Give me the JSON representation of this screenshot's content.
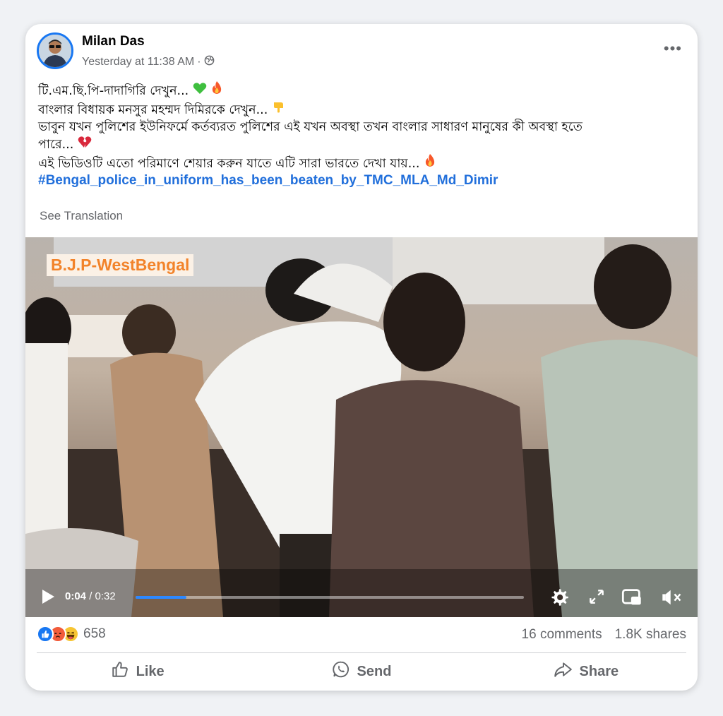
{
  "post": {
    "author": "Milan Das",
    "timestamp": "Yesterday at 11:38 AM",
    "separator": "·",
    "privacy_icon": "globe-icon",
    "more_label": "•••",
    "text_lines": [
      "টি.এম.ছি.পি-দাদাগিরি দেখুন...",
      "বাংলার বিধায়ক মনসুর মহম্মদ দিমিরকে দেখুন...",
      "ভাবুন যখন পুলিশের ইউনিফর্মে কর্তব্যরত পুলিশের এই যখন অবস্থা তখন বাংলার সাধারণ মানুষের কী অবস্থা হতে",
      "পারে...",
      "এই ভিডিওটি এতো পরিমাণে শেয়ার করুন যাতে এটি সারা ভারতে দেখা যায়..."
    ],
    "hashtag": "#Bengal_police_in_uniform_has_been_beaten_by_TMC_MLA_Md_Dimir",
    "see_translation": "See Translation"
  },
  "video": {
    "watermark": "B.J.P-WestBengal",
    "current_time": "0:04",
    "duration": "/ 0:32",
    "progress": 0.13
  },
  "engagement": {
    "reaction_icons": [
      "like-icon",
      "angry-icon",
      "haha-icon"
    ],
    "reaction_count": "658",
    "comments": "16 comments",
    "shares": "1.8K shares"
  },
  "actions": {
    "like": "Like",
    "send": "Send",
    "share": "Share"
  },
  "colors": {
    "accent": "#1877f2",
    "hashtag": "#216fdb",
    "secondary_text": "#65676b",
    "progress": "#2d88ff",
    "watermark": "#f2832a"
  }
}
